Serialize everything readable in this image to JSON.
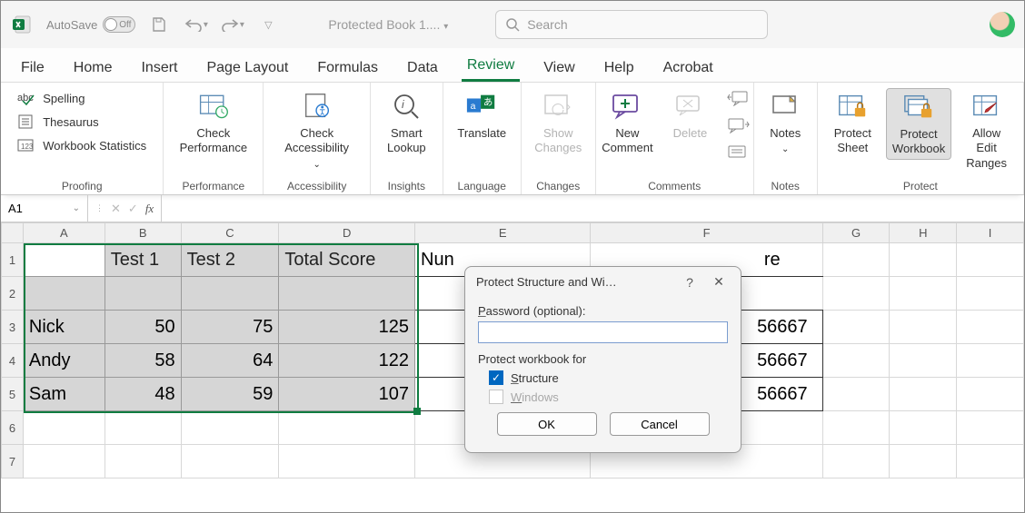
{
  "titlebar": {
    "autosave_label": "AutoSave",
    "autosave_state": "Off",
    "filename": "Protected Book 1....",
    "search_placeholder": "Search"
  },
  "tabs": [
    "File",
    "Home",
    "Insert",
    "Page Layout",
    "Formulas",
    "Data",
    "Review",
    "View",
    "Help",
    "Acrobat"
  ],
  "active_tab": "Review",
  "ribbon": {
    "proofing": {
      "label": "Proofing",
      "spelling": "Spelling",
      "thesaurus": "Thesaurus",
      "workbook_stats": "Workbook Statistics"
    },
    "performance": {
      "label": "Performance",
      "check_performance": "Check\nPerformance"
    },
    "accessibility": {
      "label": "Accessibility",
      "check_accessibility": "Check\nAccessibility"
    },
    "insights": {
      "label": "Insights",
      "smart_lookup": "Smart\nLookup"
    },
    "language": {
      "label": "Language",
      "translate": "Translate"
    },
    "changes": {
      "label": "Changes",
      "show_changes": "Show\nChanges"
    },
    "comments": {
      "label": "Comments",
      "new_comment": "New\nComment",
      "delete": "Delete",
      "notes": "Notes"
    },
    "notes_group": {
      "label": "Notes"
    },
    "protect": {
      "label": "Protect",
      "protect_sheet": "Protect\nSheet",
      "protect_workbook": "Protect\nWorkbook",
      "allow_edit_ranges": "Allow Edit\nRanges"
    }
  },
  "formula_bar": {
    "cell_ref": "A1",
    "fx": "fx",
    "value": ""
  },
  "columns": [
    "A",
    "B",
    "C",
    "D",
    "E",
    "F",
    "G",
    "H",
    "I"
  ],
  "rows": [
    "1",
    "2",
    "3",
    "4",
    "5",
    "6",
    "7"
  ],
  "headers": {
    "b": "Test 1",
    "c": "Test 2",
    "d": "Total Score",
    "e": "Nun",
    "f_tail": "re"
  },
  "data_rows": [
    {
      "name": "Nick",
      "t1": "50",
      "t2": "75",
      "total": "125",
      "f_tail": "56667"
    },
    {
      "name": "Andy",
      "t1": "58",
      "t2": "64",
      "total": "122",
      "f_tail": "56667"
    },
    {
      "name": "Sam",
      "t1": "48",
      "t2": "59",
      "total": "107",
      "f_tail": "56667"
    }
  ],
  "dialog": {
    "title": "Protect Structure and Wi…",
    "password_label": "Password (optional):",
    "protect_for": "Protect workbook for",
    "structure": "Structure",
    "windows": "Windows",
    "ok": "OK",
    "cancel": "Cancel"
  }
}
